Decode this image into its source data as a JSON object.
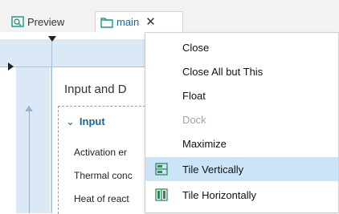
{
  "tabs": [
    {
      "label": "Preview",
      "icon": "preview-icon"
    },
    {
      "label": "main",
      "icon": "folder-icon",
      "close": "✕"
    }
  ],
  "builder": {
    "section_title": "Input and D",
    "group_header": "Input",
    "group_chevron": "⌄",
    "rows": [
      "Activation er",
      "Thermal conc",
      "Heat of react"
    ]
  },
  "context_menu": {
    "items": [
      {
        "label": "Close",
        "enabled": true
      },
      {
        "label": "Close All but This",
        "enabled": true
      },
      {
        "label": "Float",
        "enabled": true
      },
      {
        "label": "Dock",
        "enabled": false
      },
      {
        "label": "Maximize",
        "enabled": true
      },
      {
        "label": "Tile Vertically",
        "enabled": true,
        "icon": "tile-vertically-icon",
        "highlighted": true
      },
      {
        "label": "Tile Horizontally",
        "enabled": true,
        "icon": "tile-horizontally-icon"
      }
    ]
  },
  "colors": {
    "accent": "#1c64a6",
    "menu_highlight": "#cce4f7",
    "ruler": "#dbe9f7",
    "icon_green": "#2e8b57",
    "icon_teal": "#1f9a8a"
  }
}
